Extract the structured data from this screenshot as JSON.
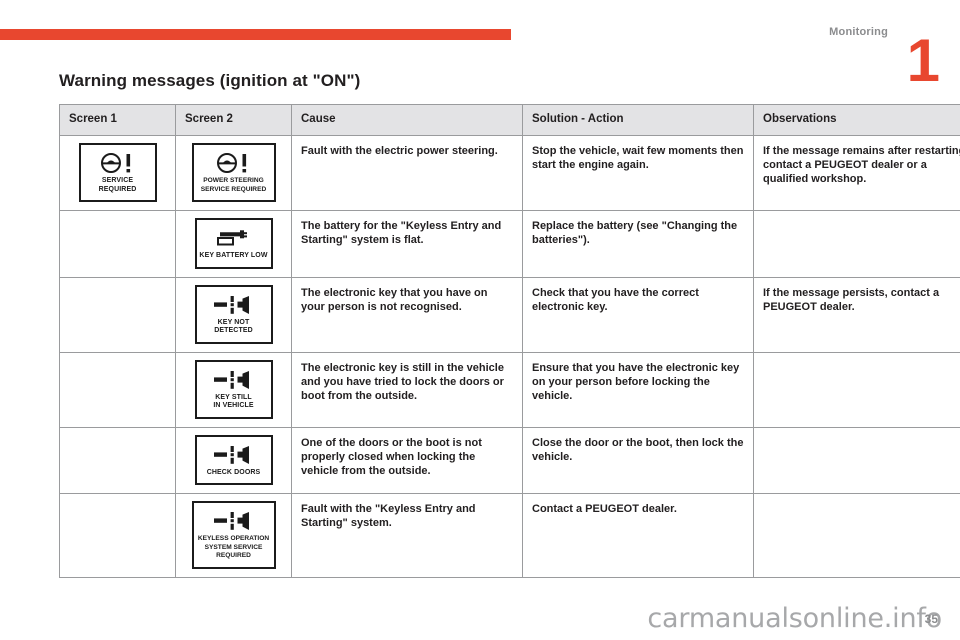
{
  "header": {
    "chapter_label": "Monitoring",
    "chapter_number": "1",
    "rule_color": "#e8472f"
  },
  "section": {
    "title": "Warning messages (ignition at \"ON\")"
  },
  "table": {
    "columns": [
      "Screen 1",
      "Screen 2",
      "Cause",
      "Solution - Action",
      "Observations"
    ],
    "rows": [
      {
        "screen1": {
          "icon": "steering-wheel-warning-icon",
          "label": "SERVICE REQUIRED"
        },
        "screen2": {
          "icon": "steering-wheel-warning-icon",
          "label": "POWER STEERING\nSERVICE REQUIRED"
        },
        "cause": "Fault with the electric power steering.",
        "solution": "Stop the vehicle, wait few moments then start the engine again.",
        "observations": "If the message remains after restarting, contact a PEUGEOT dealer or a qualified workshop."
      },
      {
        "screen1": {
          "icon": "",
          "label": ""
        },
        "screen2": {
          "icon": "key-battery-icon",
          "label": "KEY BATTERY LOW"
        },
        "cause": "The battery for the \"Keyless Entry and Starting\" system is flat.",
        "solution": "Replace the battery (see \"Changing the batteries\").",
        "observations": ""
      },
      {
        "screen1": {
          "icon": "",
          "label": ""
        },
        "screen2": {
          "icon": "keyless-signal-icon",
          "label": "KEY NOT DETECTED"
        },
        "cause": "The electronic key that you have on your person is not recognised.",
        "solution": "Check that you have the correct electronic key.",
        "observations": "If the message persists, contact a PEUGEOT dealer."
      },
      {
        "screen1": {
          "icon": "",
          "label": ""
        },
        "screen2": {
          "icon": "keyless-signal-icon",
          "label": "KEY STILL\nIN VEHICLE"
        },
        "cause": "The electronic key is still in the vehicle and you have tried to lock the doors or boot from the outside.",
        "solution": "Ensure that you have the electronic key on your person before locking the vehicle.",
        "observations": ""
      },
      {
        "screen1": {
          "icon": "",
          "label": ""
        },
        "screen2": {
          "icon": "keyless-signal-icon",
          "label": "CHECK DOORS"
        },
        "cause": "One of the doors or the boot is not properly closed when locking the vehicle from the outside.",
        "solution": "Close the door or the boot, then lock the vehicle.",
        "observations": ""
      },
      {
        "screen1": {
          "icon": "",
          "label": ""
        },
        "screen2": {
          "icon": "keyless-signal-icon",
          "label": "KEYLESS OPERATION\nSYSTEM SERVICE\nREQUIRED"
        },
        "cause": "Fault with the \"Keyless Entry and Starting\" system.",
        "solution": "Contact a PEUGEOT dealer.",
        "observations": ""
      }
    ]
  },
  "footer": {
    "watermark": "carmanualsonline.info",
    "page_number": "35"
  }
}
